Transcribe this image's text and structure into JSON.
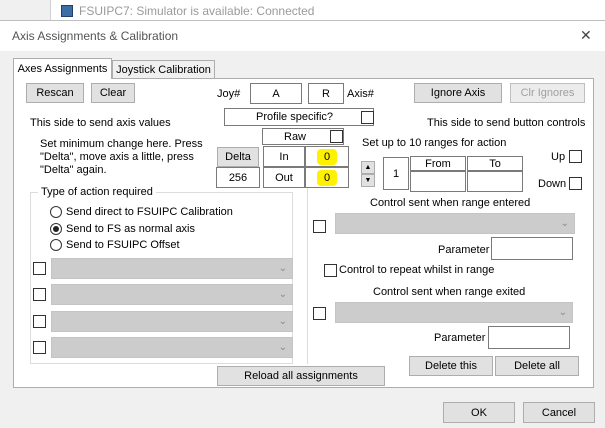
{
  "background_window": {
    "title": "FSUIPC7: Simulator is available: Connected"
  },
  "dialog": {
    "title": "Axis Assignments & Calibration",
    "close_glyph": "✕"
  },
  "tabs": [
    {
      "label": "Axes Assignments"
    },
    {
      "label": "Joystick Calibration"
    }
  ],
  "toolbar": {
    "rescan": "Rescan",
    "clear": "Clear",
    "ignore_axis": "Ignore Axis",
    "clr_ignores": "Clr Ignores"
  },
  "joy": {
    "label": "Joy#",
    "value": "A"
  },
  "axis": {
    "label": "Axis#",
    "value": "R"
  },
  "profile": {
    "label": "Profile specific?"
  },
  "left_hint": "This side to send axis values",
  "right_hint": "This side to send button controls",
  "delta_info": "Set minimum change  here.  Press \"Delta\", move axis a little,  press \"Delta\" again.",
  "delta": {
    "button": "Delta",
    "value": "256"
  },
  "raw": {
    "label": "Raw",
    "in_label": "In",
    "in_value": "0",
    "out_label": "Out",
    "out_value": "0"
  },
  "action_group": {
    "title": "Type of action required",
    "options": [
      {
        "label": "Send direct to FSUIPC Calibration",
        "selected": false
      },
      {
        "label": "Send to FS as normal axis",
        "selected": true
      },
      {
        "label": "Send to FSUIPC Offset",
        "selected": false
      }
    ]
  },
  "ranges": {
    "title": "Set up to 10 ranges for action",
    "index": "1",
    "from": "From",
    "to": "To",
    "up": "Up",
    "down": "Down",
    "entered_title": "Control sent when range entered",
    "parameter": "Parameter",
    "repeat": "Control to repeat whilst in range",
    "exited_title": "Control sent when range exited",
    "delete_this": "Delete this",
    "delete_all": "Delete all"
  },
  "reload": "Reload all assignments",
  "footer": {
    "ok": "OK",
    "cancel": "Cancel"
  },
  "colors": {
    "highlight": "#fff200",
    "accent": "#0078d7"
  }
}
